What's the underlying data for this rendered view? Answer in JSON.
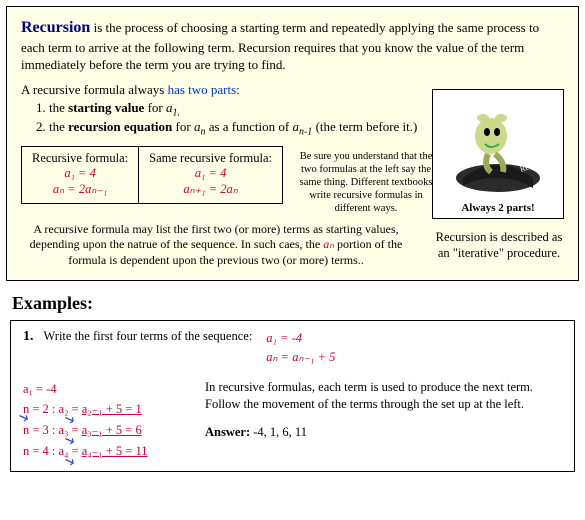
{
  "section": {
    "title_word": "Recursion",
    "intro_rest": " is the process of choosing a starting term and repeatedly applying the same process to each term to arrive at the following term.  Recursion requires that you know the value of the term immediately before the term you are trying to find.",
    "parts_lead": "A recursive formula always ",
    "parts_link": "has two parts",
    "parts_colon": ":",
    "part1_pre": "the ",
    "part1_bold": "starting value",
    "part1_post": " for ",
    "part1_sym": "a",
    "part1_sub": "1.",
    "part2_pre": "the ",
    "part2_bold": "recursion equation",
    "part2_post": " for ",
    "part2_sym": "a",
    "part2_sub": "n",
    "part2_tail1": " as a function of ",
    "part2_sym2": "a",
    "part2_sub2": "n-1",
    "part2_tail2": " (the term before it.)"
  },
  "table": {
    "h1": "Recursive formula:",
    "h2": "Same recursive formula:",
    "c1a": "a₁ = 4",
    "c1b": "aₙ = 2aₙ₋₁",
    "c2a": "a₁ = 4",
    "c2b": "aₙ₊₁ = 2aₙ"
  },
  "side_note": "Be sure you understand that the two formulas at the left say the same thing. Different textbooks write recursive formulas in different ways.",
  "image_caption": "Always 2 parts!",
  "image_label": "Recursion",
  "foot_note_pre": "A recursive formula may list the first two (or more) terms as starting values, depending upon the natrue of the sequence. In such caes, the ",
  "foot_note_sym": "aₙ",
  "foot_note_post": " portion of the formula is dependent upon the previous two (or more) terms..",
  "rec_desc": "Recursion is described as an \"iterative\" procedure.",
  "examples_hdr": "Examples:",
  "example1": {
    "num": "1.",
    "prompt": "Write the first four terms of the sequence:",
    "seq1": "a₁ = -4",
    "seq2": "aₙ = aₙ₋₁ + 5",
    "w1": "a₁ = -4",
    "w2_pre": "n = 2 :  a₂ = ",
    "w2_mid": "a₂₋₁ + 5 = 1",
    "w3_pre": "n = 3 :  a₃ = ",
    "w3_mid": "a₃₋₁ + 5 = 6",
    "w4_pre": "n = 4 :  a₄ = ",
    "w4_mid": "a₄₋₁ + 5 = 11",
    "explain": "In recursive formulas, each term is used to produce the next term.  Follow the movement of the terms through the set up at the left.",
    "answer_label": "Answer:",
    "answer": "  -4, 1, 6, 11"
  }
}
